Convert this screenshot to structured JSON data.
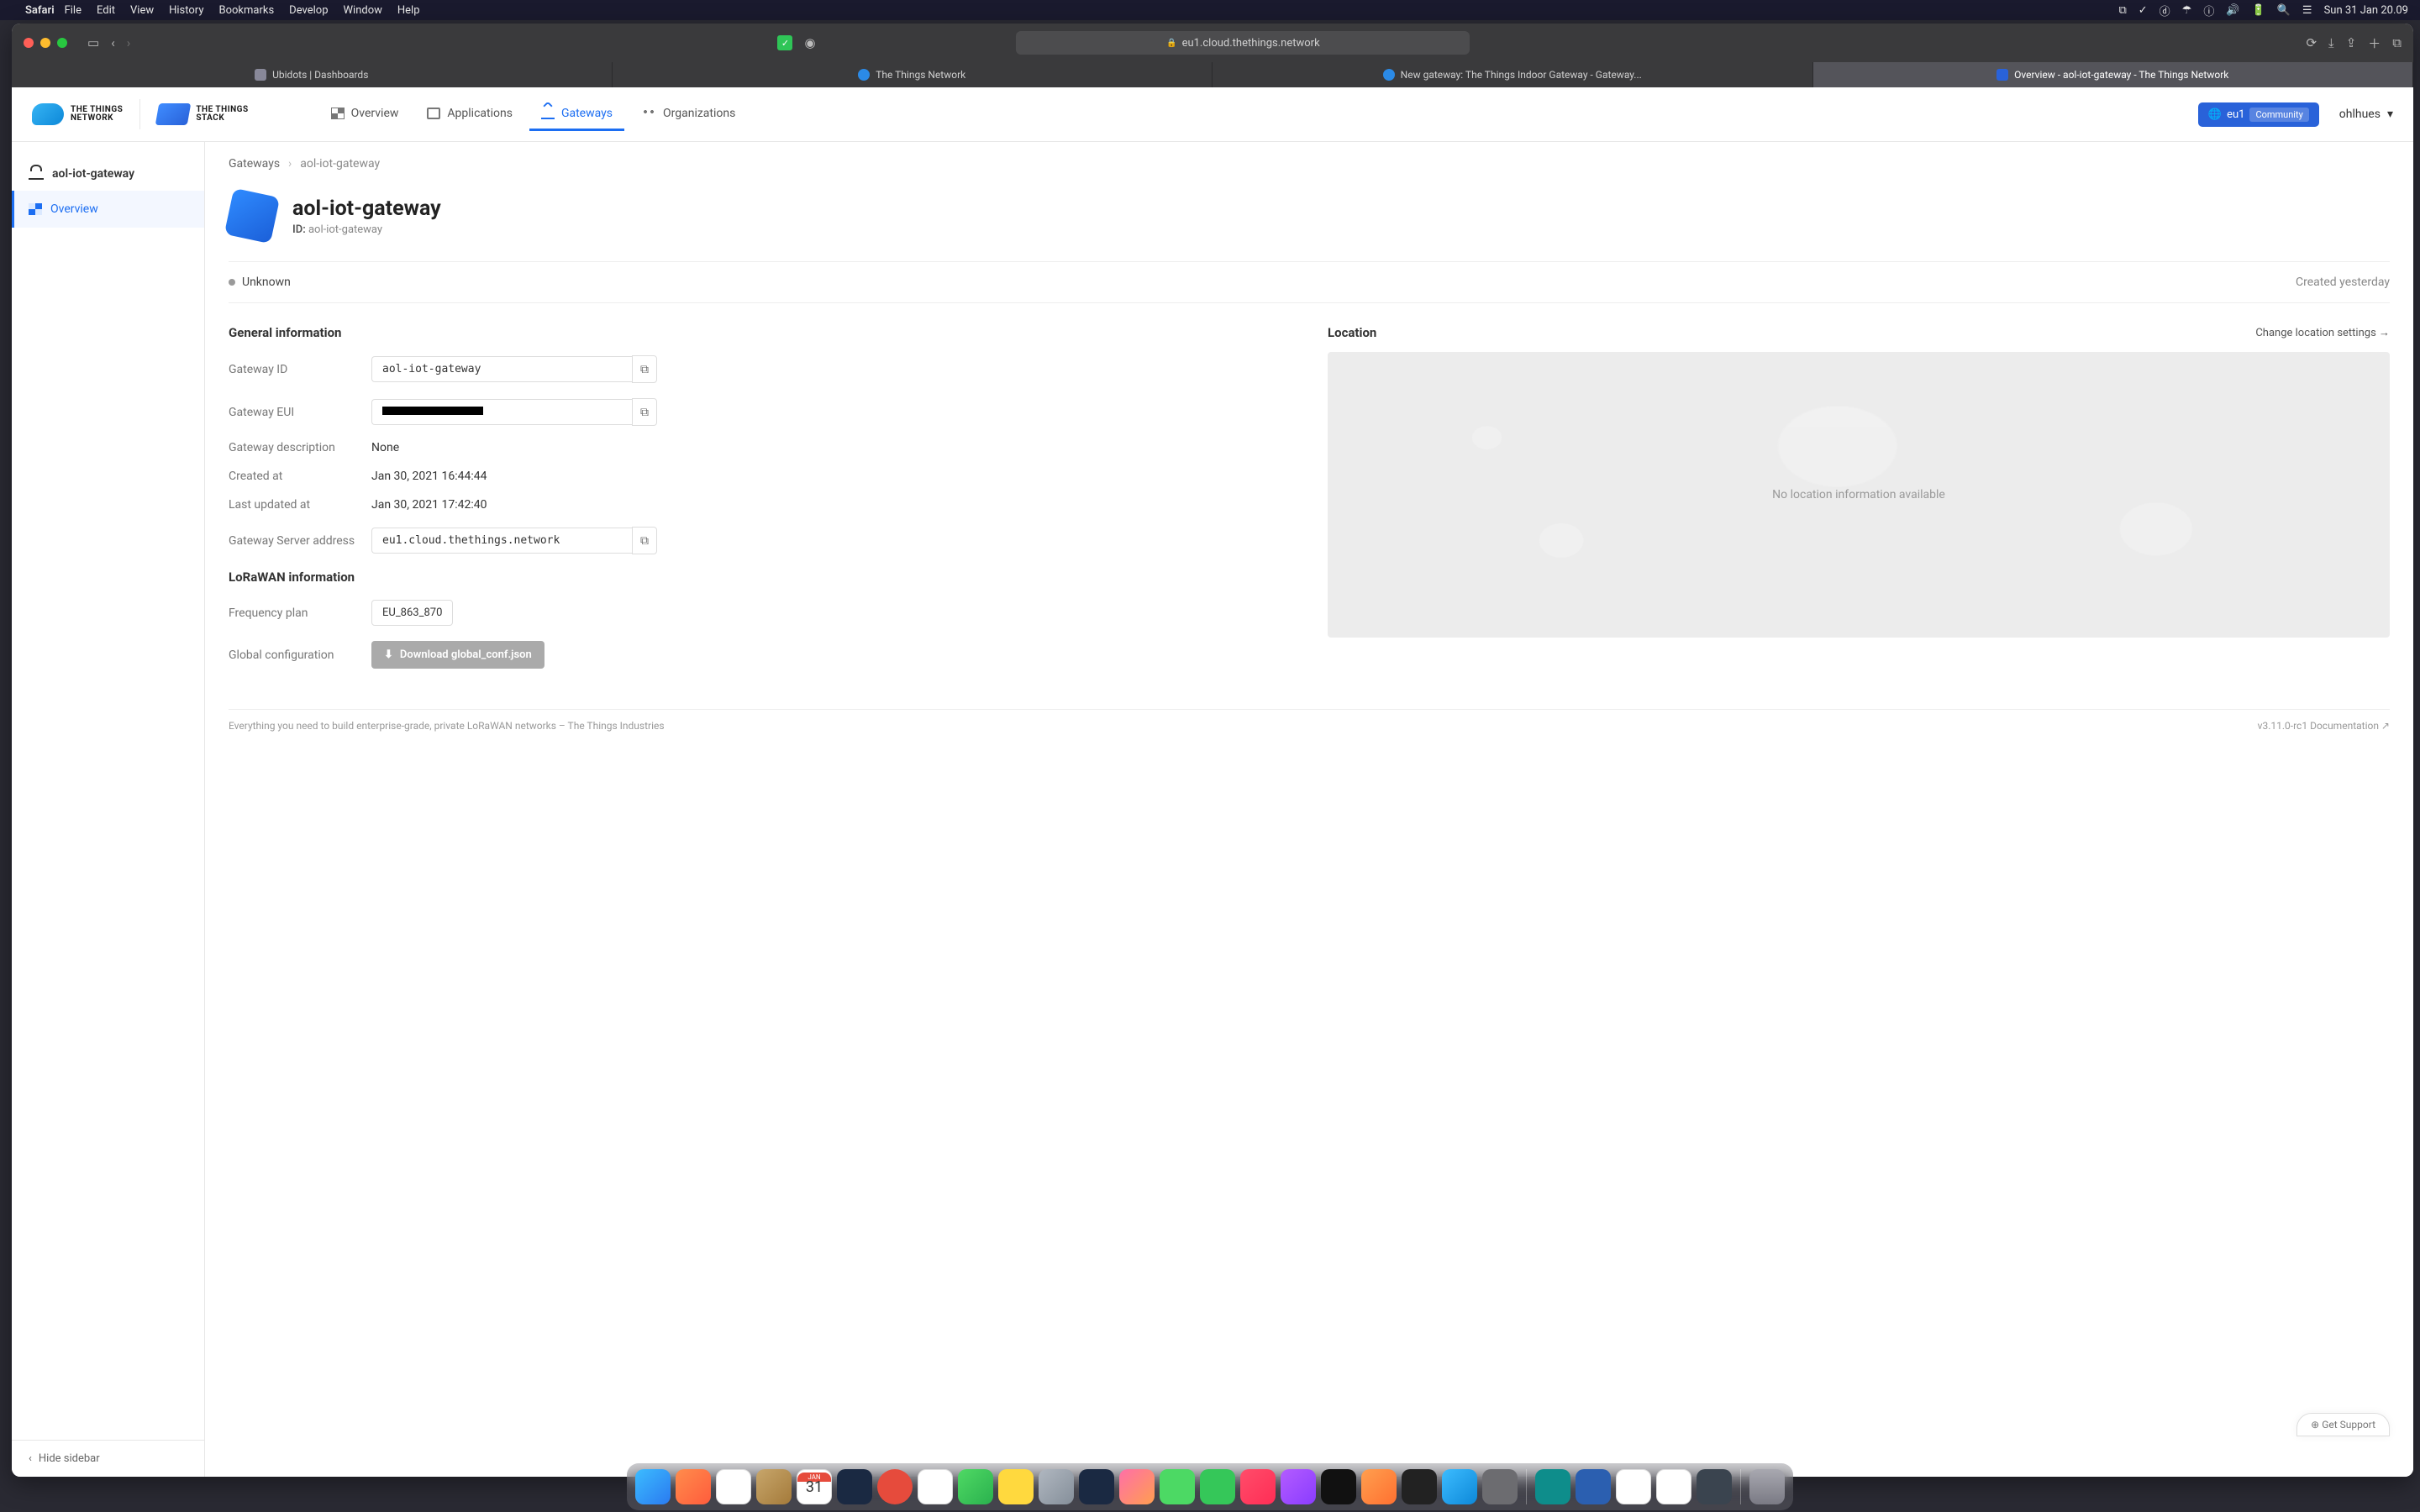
{
  "menubar": {
    "app": "Safari",
    "items": [
      "File",
      "Edit",
      "View",
      "History",
      "Bookmarks",
      "Develop",
      "Window",
      "Help"
    ],
    "clock": "Sun 31 Jan  20.09"
  },
  "browser": {
    "url": "eu1.cloud.thethings.network",
    "tabs": [
      {
        "label": "Ubidots | Dashboards",
        "active": false,
        "icon": "u"
      },
      {
        "label": "The Things Network",
        "active": false,
        "icon": "t"
      },
      {
        "label": "New gateway: The Things Indoor Gateway - Gateway...",
        "active": false,
        "icon": "g"
      },
      {
        "label": "Overview - aol-iot-gateway - The Things Network",
        "active": true,
        "icon": "s"
      }
    ]
  },
  "topnav": {
    "logos": {
      "ttn": "THE THINGS\nNETWORK",
      "tts": "THE THINGS\nSTACK"
    },
    "links": [
      {
        "label": "Overview",
        "active": false
      },
      {
        "label": "Applications",
        "active": false
      },
      {
        "label": "Gateways",
        "active": true
      },
      {
        "label": "Organizations",
        "active": false
      }
    ],
    "cluster": {
      "region": "eu1",
      "kind": "Community"
    },
    "user": "ohlhues"
  },
  "sidebar": {
    "gateway": "aol-iot-gateway",
    "items": [
      {
        "label": "Overview",
        "active": true
      }
    ],
    "hide_label": "Hide sidebar"
  },
  "crumbs": {
    "root": "Gateways",
    "current": "aol-iot-gateway"
  },
  "head": {
    "title": "aol-iot-gateway",
    "id_label": "ID:",
    "id_value": "aol-iot-gateway"
  },
  "status": {
    "text": "Unknown",
    "created": "Created yesterday"
  },
  "sections": {
    "general_h": "General information",
    "lorawan_h": "LoRaWAN information",
    "location_h": "Location",
    "loc_link": "Change location settings →",
    "map_empty": "No location information available"
  },
  "fields": {
    "gateway_id": {
      "label": "Gateway ID",
      "value": "aol-iot-gateway"
    },
    "gateway_eui": {
      "label": "Gateway EUI",
      "value": "████████████████"
    },
    "description": {
      "label": "Gateway description",
      "value": "None"
    },
    "created": {
      "label": "Created at",
      "value": "Jan 30, 2021 16:44:44"
    },
    "updated": {
      "label": "Last updated at",
      "value": "Jan 30, 2021 17:42:40"
    },
    "server": {
      "label": "Gateway Server address",
      "value": "eu1.cloud.thethings.network"
    },
    "freq": {
      "label": "Frequency plan",
      "value": "EU_863_870"
    },
    "global_conf": {
      "label": "Global configuration",
      "button": "Download global_conf.json"
    }
  },
  "footer": {
    "left": "Everything you need to build enterprise-grade, private LoRaWAN networks – The Things Industries",
    "right": "v3.11.0-rc1   Documentation ↗"
  },
  "support": "⊕ Get Support"
}
